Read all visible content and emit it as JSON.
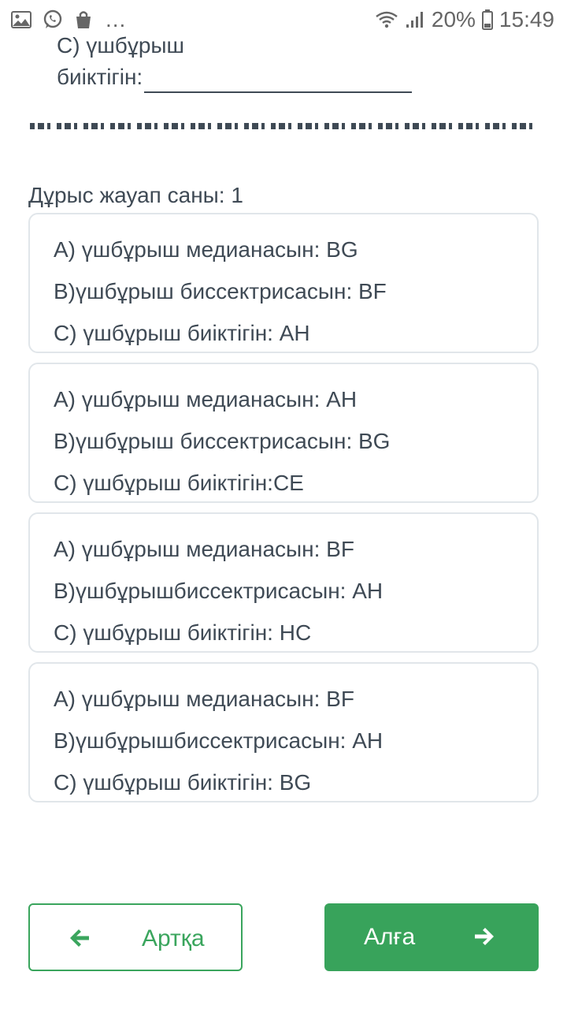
{
  "status_bar": {
    "battery_percent": "20%",
    "time": "15:49",
    "more": "...",
    "icons": [
      "image-icon",
      "whatsapp-icon",
      "shopping-bag-icon",
      "wifi-icon",
      "signal-icon",
      "battery-icon"
    ]
  },
  "question": {
    "line1": "C) үшбұрыш",
    "line2": "биіктігін:"
  },
  "correct_count": "Дұрыс жауап саны: 1",
  "options": [
    {
      "a": "A) үшбұрыш медианасын: BG",
      "b": "B)үшбұрыш биссектрисасын: BF",
      "c": "C) үшбұрыш биіктігін: AH"
    },
    {
      "a": "A) үшбұрыш медианасын: AH",
      "b": "B)үшбұрыш биссектрисасын: BG",
      "c": "C) үшбұрыш биіктігін:CE"
    },
    {
      "a": "A) үшбұрыш медианасын: BF",
      "b": "B)үшбұрышбиссектрисасын: AH",
      "c": "C) үшбұрыш биіктігін: HC"
    },
    {
      "a": "A) үшбұрыш медианасын: BF",
      "b": "B)үшбұрышбиссектрисасын: AH",
      "c": "C) үшбұрыш биіктігін: BG"
    }
  ],
  "nav": {
    "back_label": "Артқа",
    "next_label": "Алға",
    "back_icon": "arrow-left-icon",
    "next_icon": "arrow-right-icon"
  },
  "colors": {
    "accent_green": "#38a35b",
    "text": "#3f4a55",
    "card_border": "#e1e6ea"
  }
}
